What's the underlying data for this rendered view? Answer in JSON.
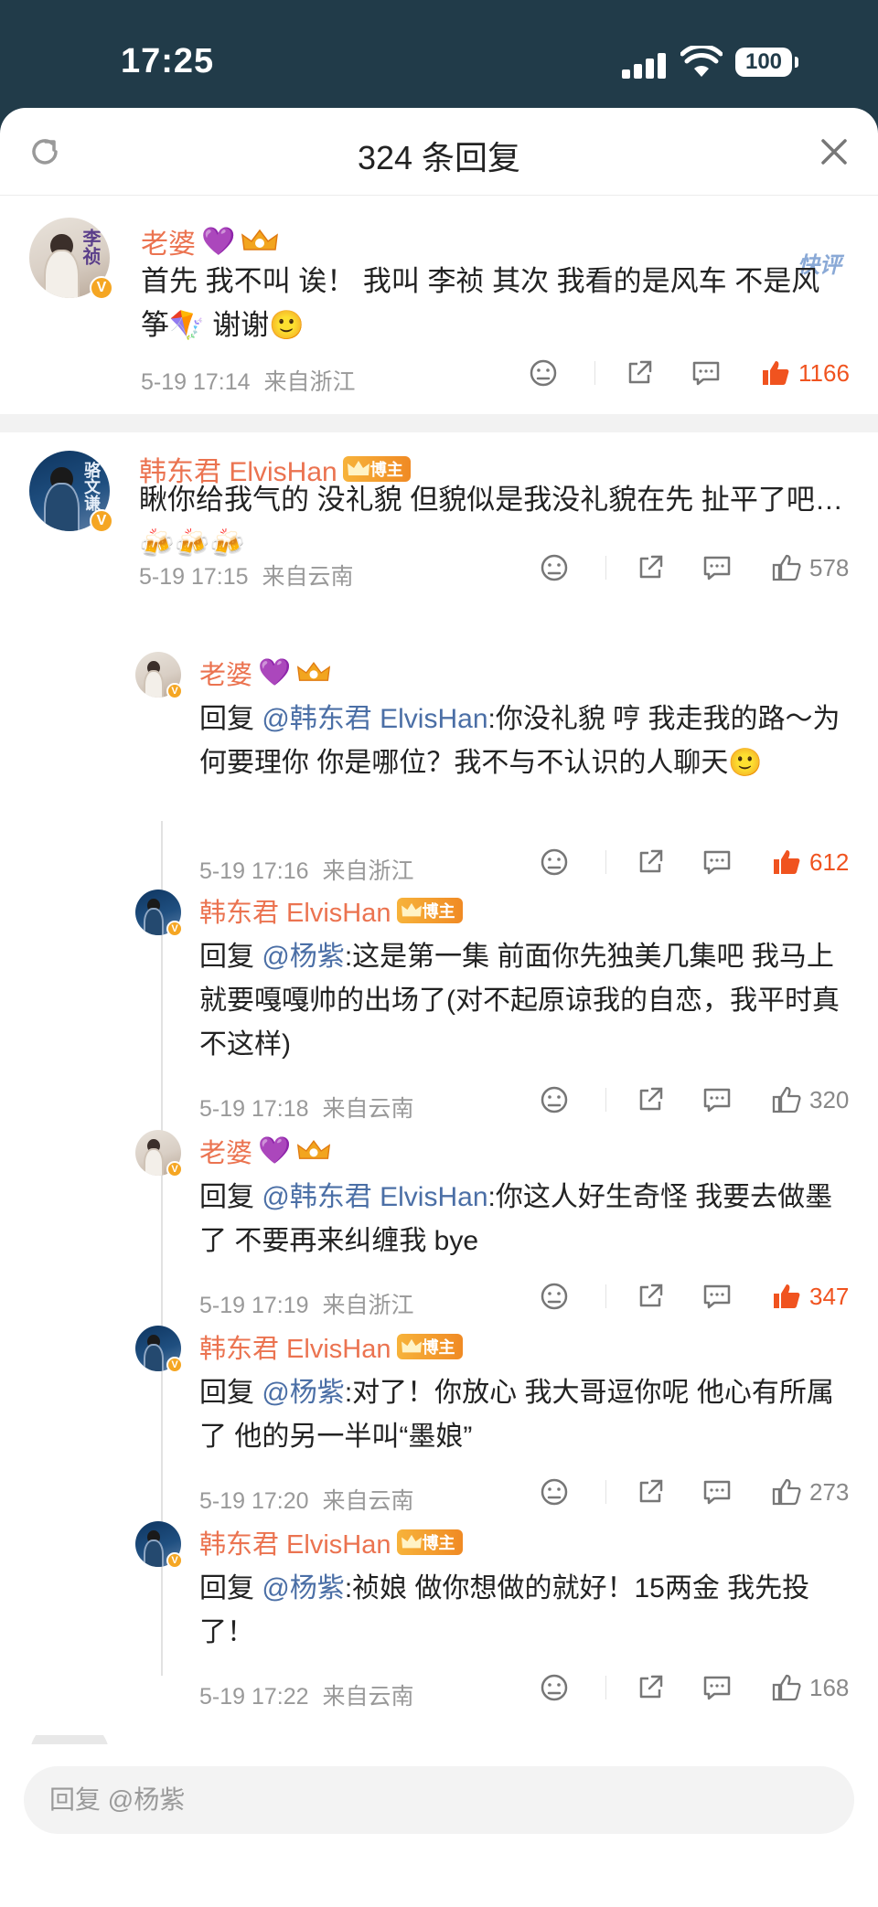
{
  "status_bar": {
    "time": "17:25",
    "battery": "100"
  },
  "header": {
    "title": "324 条回复"
  },
  "main_comment": {
    "author": "老婆",
    "heart": "💜",
    "quick_tag": "快评",
    "text": "首先 我不叫 诶！ 我叫 李祯 其次 我看的是风车 不是风筝🪁 谢谢🙂",
    "time": "5-19 17:14",
    "location": "来自浙江",
    "likes": "1166",
    "avatar_text": "李祯"
  },
  "threads": [
    {
      "author": "韩东君 ElvisHan",
      "tag": "博主",
      "text": "瞅你给我气的  没礼貌   但貌似是我没礼貌在先    扯平了吧…🍻🍻🍻",
      "time": "5-19 17:15",
      "location": "来自云南",
      "likes": "578",
      "avatar_text": "骆文谦"
    }
  ],
  "replies": [
    {
      "author": "老婆",
      "heart": "💜",
      "prefix": "回复",
      "mention": "@韩东君 ElvisHan",
      "text": ":你没礼貌 哼 我走我的路～为何要理你 你是哪位？我不与不认识的人聊天🙂",
      "time": "5-19 17:16",
      "location": "来自浙江",
      "likes": "612",
      "hot": true
    },
    {
      "author": "韩东君 ElvisHan",
      "tag": "博主",
      "prefix": "回复",
      "mention": "@杨紫",
      "text": ":这是第一集  前面你先独美几集吧   我马上就要嘎嘎帅的出场了(对不起原谅我的自恋，我平时真不这样)",
      "time": "5-19 17:18",
      "location": "来自云南",
      "likes": "320",
      "hot": false
    },
    {
      "author": "老婆",
      "heart": "💜",
      "prefix": "回复",
      "mention": "@韩东君 ElvisHan",
      "text": ":你这人好生奇怪 我要去做墨了 不要再来纠缠我 bye",
      "time": "5-19 17:19",
      "location": "来自浙江",
      "likes": "347",
      "hot": true
    },
    {
      "author": "韩东君 ElvisHan",
      "tag": "博主",
      "prefix": "回复",
      "mention": "@杨紫",
      "text": ":对了！你放心 我大哥逗你呢  他心有所属了  他的另一半叫“墨娘”",
      "time": "5-19 17:20",
      "location": "来自云南",
      "likes": "273",
      "hot": false
    },
    {
      "author": "韩东君 ElvisHan",
      "tag": "博主",
      "prefix": "回复",
      "mention": "@杨紫",
      "text": ":祯娘  做你想做的就好！15两金 我先投了！",
      "time": "5-19 17:22",
      "location": "来自云南",
      "likes": "168",
      "hot": false
    }
  ],
  "reply_box": {
    "placeholder": "回复 @杨紫"
  },
  "colors": {
    "name": "#eb7350",
    "mention": "#4b6fa6",
    "hot_like": "#f0531f",
    "meta": "#999999"
  }
}
